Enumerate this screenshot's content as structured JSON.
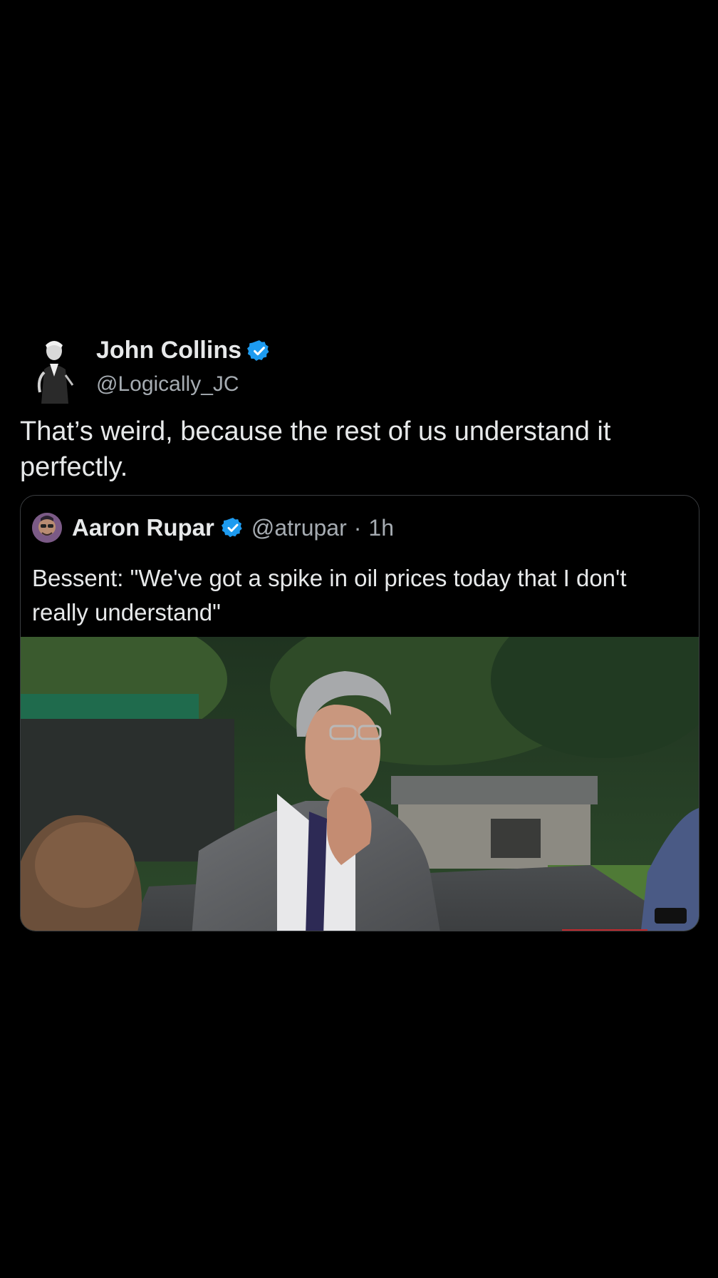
{
  "tweet": {
    "author_name": "John Collins",
    "author_handle": "@Logically_JC",
    "verified_icon": "verified-badge-icon",
    "text": "That’s weird, because the rest of us understand it perfectly."
  },
  "quoted_tweet": {
    "author_name": "Aaron Rupar",
    "author_handle": "@atrupar",
    "separator": "·",
    "time_ago": "1h",
    "verified_icon": "verified-badge-icon",
    "text": "Bessent: \"We've got a spike in oil prices today that I don't really understand\"",
    "media": "video-thumbnail"
  },
  "colors": {
    "background": "#000000",
    "text_primary": "#e7e9ea",
    "text_secondary": "#a6acb2",
    "verified_blue": "#1d9bf0",
    "card_border": "#3a3d40"
  }
}
